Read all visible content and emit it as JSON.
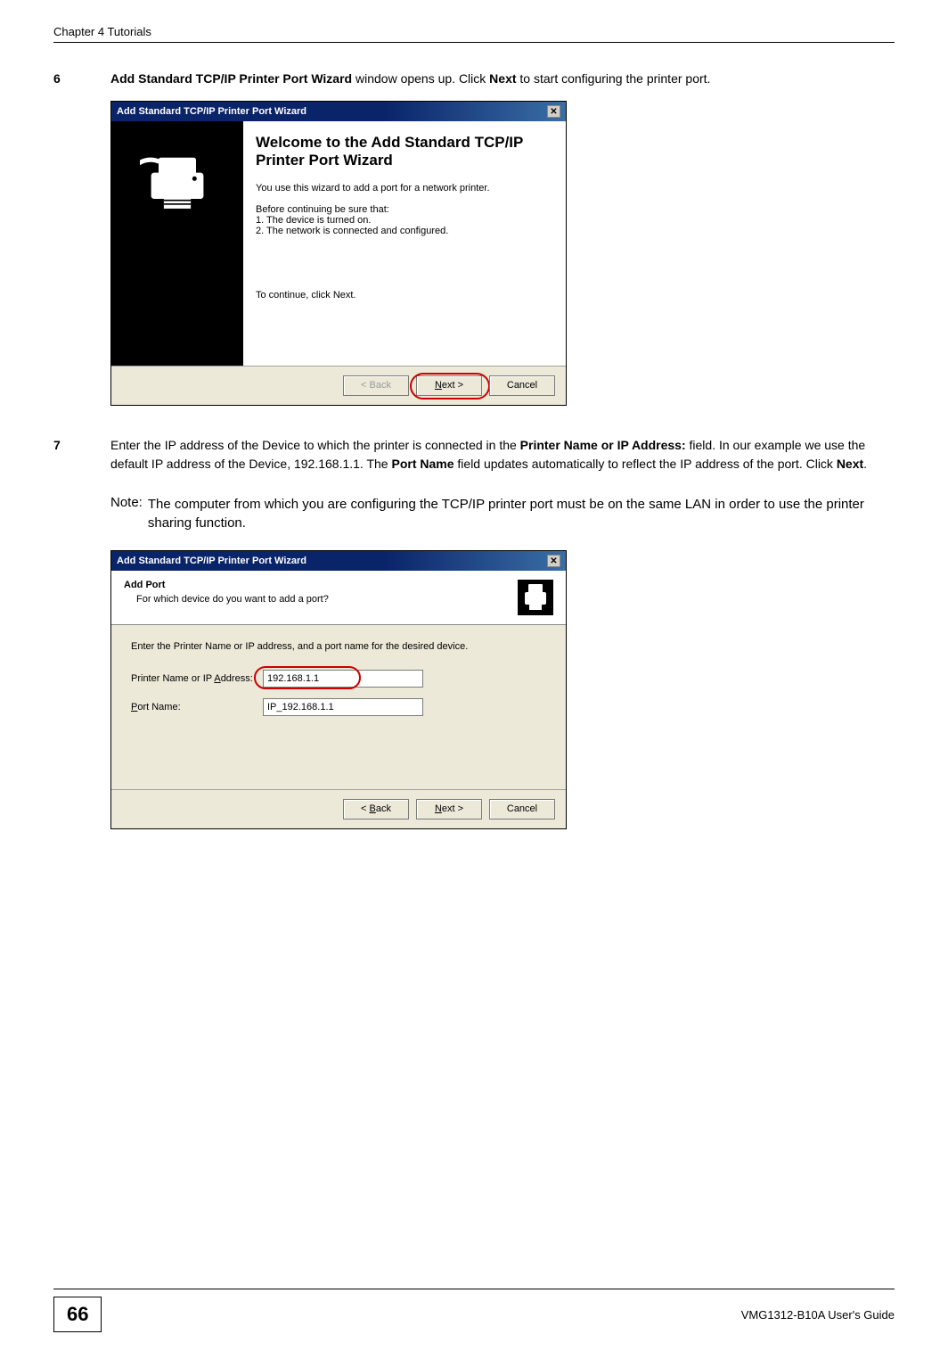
{
  "header": {
    "chapter": "Chapter 4 Tutorials"
  },
  "step6": {
    "num": "6",
    "text_pre": "",
    "bold1": "Add Standard TCP/IP Printer Port Wizard",
    "mid1": " window opens up. Click ",
    "bold2": "Next",
    "mid2": " to start configuring the printer port."
  },
  "dlg1": {
    "title": "Add Standard TCP/IP Printer Port Wizard",
    "h": "Welcome to the Add Standard TCP/IP Printer Port Wizard",
    "p1": "You use this wizard to add a port for a network printer.",
    "p2": "Before continuing be sure that:",
    "li1": "1.  The device is turned on.",
    "li2": "2.  The network is connected and configured.",
    "p3": "To continue, click Next.",
    "btn_back": "< Back",
    "btn_next_pre": "N",
    "btn_next_post": "ext >",
    "btn_cancel": "Cancel"
  },
  "step7": {
    "num": "7",
    "pre": "Enter the IP address of the Device to which the printer is connected in the ",
    "bold1": "Printer Name or IP Address:",
    "mid1": " field. In our example we use the default IP address of the Device, 192.168.1.1. The ",
    "bold2": "Port Name",
    "mid2": " field updates automatically to reflect the IP address of the port. Click ",
    "bold3": "Next",
    "mid3": "."
  },
  "note": {
    "label": "Note:",
    "text": "The computer from which you are configuring the TCP/IP printer port must be on the same LAN in order to use the printer sharing function."
  },
  "dlg2": {
    "title": "Add Standard TCP/IP Printer Port Wizard",
    "head_title": "Add Port",
    "head_sub": "For which device do you want to add a port?",
    "instr": "Enter the Printer Name or IP address, and a port name for the desired device.",
    "lab1_pre": "Printer Name or IP ",
    "lab1_u": "A",
    "lab1_post": "ddress:",
    "val1": "192.168.1.1",
    "lab2_u": "P",
    "lab2_post": "ort Name:",
    "val2": "IP_192.168.1.1",
    "btn_back_u": "B",
    "btn_back_post": "ack",
    "btn_back_pre": "< ",
    "btn_next_u": "N",
    "btn_next_post": "ext >",
    "btn_cancel": "Cancel"
  },
  "footer": {
    "page": "66",
    "guide": "VMG1312-B10A User's Guide"
  }
}
